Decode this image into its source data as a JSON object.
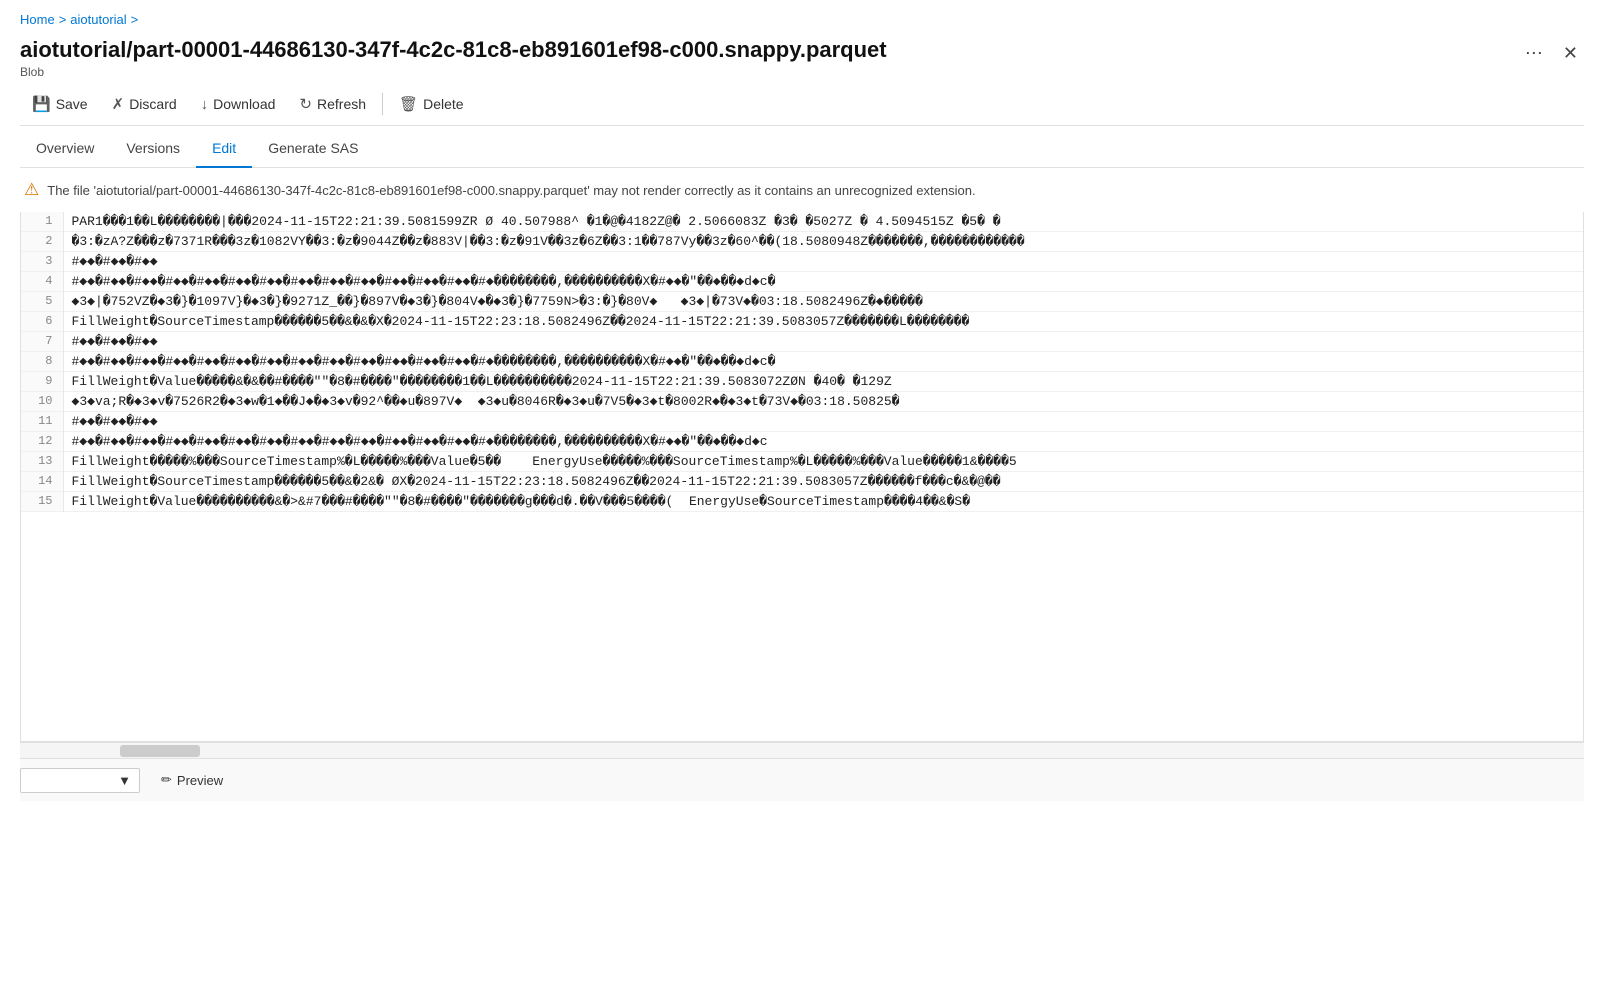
{
  "breadcrumb": {
    "home": "Home",
    "separator1": ">",
    "tutorial": "aiotutorial",
    "separator2": ">"
  },
  "file": {
    "title": "aiotutorial/part-00001-44686130-347f-4c2c-81c8-eb891601ef98-c000.snappy.parquet",
    "type": "Blob"
  },
  "toolbar": {
    "save": "Save",
    "discard": "Discard",
    "download": "Download",
    "refresh": "Refresh",
    "delete": "Delete"
  },
  "tabs": [
    {
      "id": "overview",
      "label": "Overview"
    },
    {
      "id": "versions",
      "label": "Versions"
    },
    {
      "id": "edit",
      "label": "Edit",
      "active": true
    },
    {
      "id": "generate-sas",
      "label": "Generate SAS"
    }
  ],
  "warning": {
    "message": "The file 'aiotutorial/part-00001-44686130-347f-4c2c-81c8-eb891601ef98-c000.snappy.parquet' may not render correctly as it contains an unrecognized extension."
  },
  "lines": [
    {
      "num": 1,
      "content": "PAR1���1��L��������|���2024-11-15T22:21:39.5081599ZR Ø 40.507988^ �1�@�4182Z@� 2.5066083Z �3� �5027Z � 4.5094515Z �5� �"
    },
    {
      "num": 2,
      "content": "�3:�zA?Z���z�7371R���3z�1082VY��3:�z�9044Z��z�883V|��3:�z�91V��3z�6Z��3:1��787Vy��3z�60^��(18.5080948Z�������,������������"
    },
    {
      "num": 3,
      "content": "#◆◆�#◆◆�#◆◆"
    },
    {
      "num": 4,
      "content": "#◆◆�#◆◆�#◆◆�#◆◆�#◆◆�#◆◆�#◆◆�#◆◆�#◆◆�#◆◆�#◆◆�#◆◆�#◆◆�#◆��������,����������X�#◆◆�\"��◆��◆d◆c�"
    },
    {
      "num": 5,
      "content": "◆3◆|�752VZ�◆3�}�1097V}�◆3�}�9271Z_��}�897V�◆3�}�804V◆�◆3�}�7759N>�3:�}�80V◆   ◆3◆|�73V◆�03:18.5082496Z�◆�����"
    },
    {
      "num": 6,
      "content": "FillWeight�SourceTimestamp������5��&�&�X�2024-11-15T22:23:18.5082496Z��2024-11-15T22:21:39.5083057Z�������L��������"
    },
    {
      "num": 7,
      "content": "#◆◆�#◆◆�#◆◆"
    },
    {
      "num": 8,
      "content": "#◆◆�#◆◆�#◆◆�#◆◆�#◆◆�#◆◆�#◆◆�#◆◆�#◆◆�#◆◆�#◆◆�#◆◆�#◆◆�#◆��������,����������X�#◆◆�\"��◆��◆d◆c�"
    },
    {
      "num": 9,
      "content": "FillWeight�Value�����&�&��#����\"\"�8�#����\"��������1��L����������2024-11-15T22:21:39.5083072ZØN �40� �129Z"
    },
    {
      "num": 10,
      "content": "◆3◆va;R�◆3◆v�7526R2�◆3◆w�1◆��J◆�◆3◆v�92^��◆u�897V◆  ◆3◆u�8046R�◆3◆u�7V5�◆3◆t�8002R◆�◆3◆t�73V◆�03:18.50825�"
    },
    {
      "num": 11,
      "content": "#◆◆�#◆◆�#◆◆"
    },
    {
      "num": 12,
      "content": "#◆◆�#◆◆�#◆◆�#◆◆�#◆◆�#◆◆�#◆◆�#◆◆�#◆◆�#◆◆�#◆◆�#◆◆�#◆◆�#◆��������,����������X�#◆◆�\"��◆��◆d◆c"
    },
    {
      "num": 13,
      "content": "FillWeight�����%���SourceTimestamp%�L�����%���Value�5��    EnergyUse�����%���SourceTimestamp%�L�����%���Value�����1&����5"
    },
    {
      "num": 14,
      "content": "FillWeight�SourceTimestamp������5��&�2&� ØX�2024-11-15T22:23:18.5082496Z��2024-11-15T22:21:39.5083057Z������f���c�&�@��"
    },
    {
      "num": 15,
      "content": "FillWeight�Value����������&�>&#7���#����\"\"�8�#����\"�������g���d�.��V���5����(  EnergyUse�SourceTimestamp����4��&�S�"
    }
  ],
  "bottom": {
    "encoding_placeholder": "",
    "preview_label": "Preview",
    "pencil_icon": "✏"
  },
  "colors": {
    "accent": "#0078d4",
    "warning": "#d97706"
  }
}
